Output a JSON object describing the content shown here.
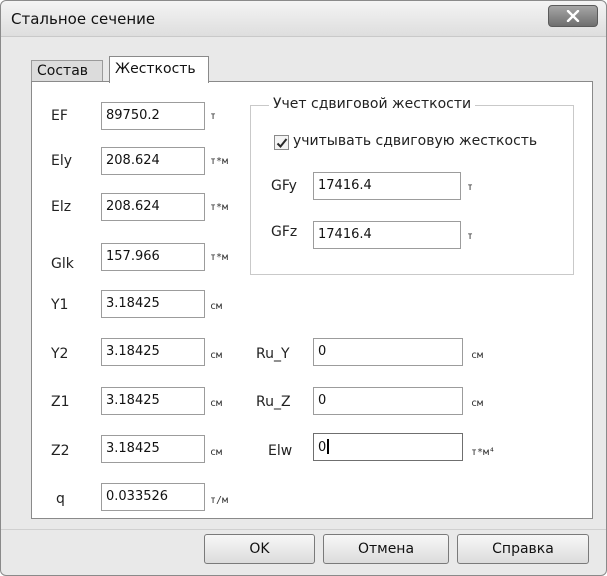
{
  "window": {
    "title": "Стальное сечение",
    "close_icon": "close-x-icon"
  },
  "tabs": [
    {
      "label": "Состав",
      "active": false
    },
    {
      "label": "Жесткость",
      "active": true
    }
  ],
  "left_fields": [
    {
      "label": "EF",
      "value": "89750.2",
      "unit": "т"
    },
    {
      "label": "Ely",
      "value": "208.624",
      "unit": "т*м"
    },
    {
      "label": "Elz",
      "value": "208.624",
      "unit": "т*м"
    },
    {
      "label": "Glk",
      "value": "157.966",
      "unit": "т*м"
    },
    {
      "label": "Y1",
      "value": "3.18425",
      "unit": "см"
    },
    {
      "label": "Y2",
      "value": "3.18425",
      "unit": "см"
    },
    {
      "label": "Z1",
      "value": "3.18425",
      "unit": "см"
    },
    {
      "label": "Z2",
      "value": "3.18425",
      "unit": "см"
    },
    {
      "label": "q",
      "value": "0.033526",
      "unit": "т/м"
    }
  ],
  "shear_group": {
    "title": "Учет сдвиговой жесткости",
    "checkbox_label": "учитывать сдвиговую жесткость",
    "checked": true,
    "fields": [
      {
        "label": "GFy",
        "value": "17416.4",
        "unit": "т"
      },
      {
        "label": "GFz",
        "value": "17416.4",
        "unit": "т"
      }
    ]
  },
  "right_fields": [
    {
      "label": "Ru_Y",
      "value": "0",
      "unit": "см"
    },
    {
      "label": "Ru_Z",
      "value": "0",
      "unit": "см"
    },
    {
      "label": "Elw",
      "value": "0",
      "unit": "т*м⁴"
    }
  ],
  "buttons": {
    "ok": "OK",
    "cancel": "Отмена",
    "help": "Справка"
  }
}
